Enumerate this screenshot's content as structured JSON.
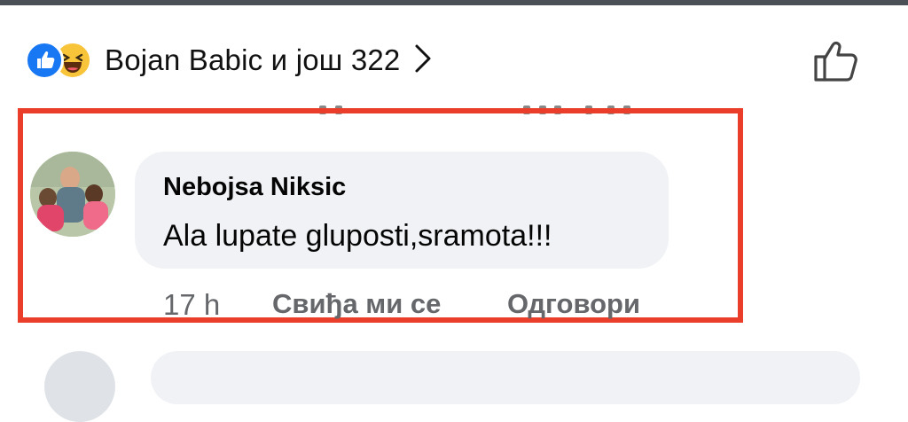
{
  "reactions": {
    "icons": [
      "like-icon",
      "haha-icon"
    ],
    "text": "Bojan Babic и још 322"
  },
  "comment": {
    "author": "Nebojsa Niksic",
    "text": "Ala lupate gluposti,sramota!!!",
    "time": "17 h",
    "like_label": "Свиђа ми се",
    "reply_label": "Одговори"
  },
  "colors": {
    "highlight": "#ea3d2a",
    "like_blue": "#1877f2",
    "haha_yellow": "#f7c43a",
    "bubble_bg": "#f0f2f5",
    "meta_gray": "#65676b"
  }
}
